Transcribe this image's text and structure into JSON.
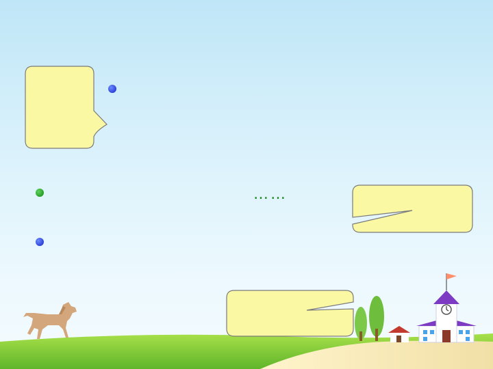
{
  "callouts": {
    "topic": "    ",
    "mid": "    ",
    "bottom": "    "
  },
  "paragraphs": {
    "p1_line1": "　　　　　　　　　　　　　　　　　　　　",
    "p1_line2": "　　　　　　　　　　　　　　　　　　　　",
    "p2_line1": "　　　　　　　　　　　　……",
    "p3_line1": "　　　　　　　　　　　　　　　　　　　　　　",
    "p3_line2": "　　　　　"
  },
  "colors": {
    "callout_fill": "#fbf8a3",
    "callout_text": "#e0121b",
    "text_blue": "#1a22b8",
    "text_green": "#1f8a1f"
  },
  "icons": {
    "bullets": "circle-bullet-icon",
    "horse": "horse-icon",
    "town": "school-building-icon"
  }
}
